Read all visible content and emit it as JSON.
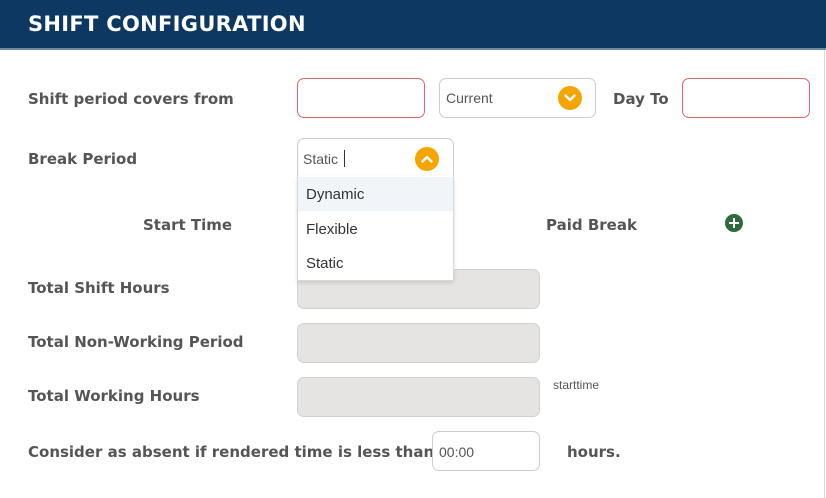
{
  "header": {
    "title": "SHIFT CONFIGURATION"
  },
  "form": {
    "shift_period_label": "Shift period covers from",
    "shift_from_value": "",
    "day_select_value": "Current",
    "day_to_label": "Day To",
    "day_to_value": "",
    "break_period_label": "Break Period",
    "break_period_value": "Static",
    "break_period_options": [
      "Dynamic",
      "Flexible",
      "Static"
    ],
    "start_time_header": "Start Time",
    "paid_break_header": "Paid Break",
    "total_shift_hours_label": "Total Shift Hours",
    "total_non_working_label": "Total Non-Working Period",
    "total_working_hours_label": "Total Working Hours",
    "starttime_note": "starttime",
    "absent_label": "Consider as absent if rendered time is less than",
    "absent_value": "00:00",
    "hours_suffix": "hours."
  },
  "colors": {
    "header_bg": "#0d3861",
    "accent": "#f5a500",
    "error_border": "#e06666",
    "add_button": "#2f6a3a"
  },
  "icons": [
    "chevron-down-icon",
    "chevron-up-icon",
    "add-circle-icon"
  ]
}
